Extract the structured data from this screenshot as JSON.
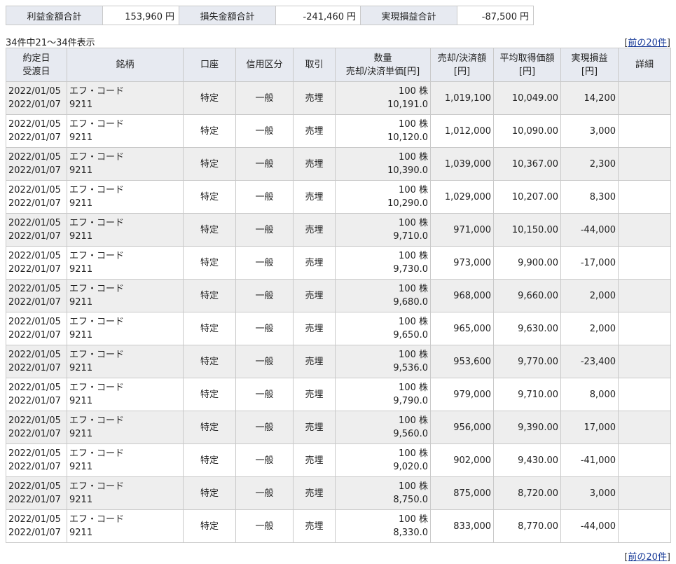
{
  "summary": {
    "profit_label": "利益金額合計",
    "profit_value": "153,960",
    "profit_unit": "円",
    "loss_label": "損失金額合計",
    "loss_value": "-241,460",
    "loss_unit": "円",
    "realized_label": "実現損益合計",
    "realized_value": "-87,500",
    "realized_unit": "円"
  },
  "count_text": "34件中21～34件表示",
  "prev_link": "前の20件",
  "headers": {
    "date1": "約定日",
    "date2": "受渡日",
    "stock": "銘柄",
    "account": "口座",
    "credit": "信用区分",
    "trade": "取引",
    "qty1": "数量",
    "qty2": "売却/決済単価[円]",
    "amount1": "売却/決済額",
    "amount2": "[円]",
    "avg1": "平均取得価額",
    "avg2": "[円]",
    "pnl1": "実現損益",
    "pnl2": "[円]",
    "detail": "詳細"
  },
  "rows": [
    {
      "trade_date": "2022/01/05",
      "settle_date": "2022/01/07",
      "name": "エフ・コード",
      "code": "9211",
      "account": "特定",
      "credit": "一般",
      "trade": "売埋",
      "qty": "100 株",
      "price": "10,191.0",
      "amount": "1,019,100",
      "avg": "10,049.00",
      "pnl": "14,200"
    },
    {
      "trade_date": "2022/01/05",
      "settle_date": "2022/01/07",
      "name": "エフ・コード",
      "code": "9211",
      "account": "特定",
      "credit": "一般",
      "trade": "売埋",
      "qty": "100 株",
      "price": "10,120.0",
      "amount": "1,012,000",
      "avg": "10,090.00",
      "pnl": "3,000"
    },
    {
      "trade_date": "2022/01/05",
      "settle_date": "2022/01/07",
      "name": "エフ・コード",
      "code": "9211",
      "account": "特定",
      "credit": "一般",
      "trade": "売埋",
      "qty": "100 株",
      "price": "10,390.0",
      "amount": "1,039,000",
      "avg": "10,367.00",
      "pnl": "2,300"
    },
    {
      "trade_date": "2022/01/05",
      "settle_date": "2022/01/07",
      "name": "エフ・コード",
      "code": "9211",
      "account": "特定",
      "credit": "一般",
      "trade": "売埋",
      "qty": "100 株",
      "price": "10,290.0",
      "amount": "1,029,000",
      "avg": "10,207.00",
      "pnl": "8,300"
    },
    {
      "trade_date": "2022/01/05",
      "settle_date": "2022/01/07",
      "name": "エフ・コード",
      "code": "9211",
      "account": "特定",
      "credit": "一般",
      "trade": "売埋",
      "qty": "100 株",
      "price": "9,710.0",
      "amount": "971,000",
      "avg": "10,150.00",
      "pnl": "-44,000"
    },
    {
      "trade_date": "2022/01/05",
      "settle_date": "2022/01/07",
      "name": "エフ・コード",
      "code": "9211",
      "account": "特定",
      "credit": "一般",
      "trade": "売埋",
      "qty": "100 株",
      "price": "9,730.0",
      "amount": "973,000",
      "avg": "9,900.00",
      "pnl": "-17,000"
    },
    {
      "trade_date": "2022/01/05",
      "settle_date": "2022/01/07",
      "name": "エフ・コード",
      "code": "9211",
      "account": "特定",
      "credit": "一般",
      "trade": "売埋",
      "qty": "100 株",
      "price": "9,680.0",
      "amount": "968,000",
      "avg": "9,660.00",
      "pnl": "2,000"
    },
    {
      "trade_date": "2022/01/05",
      "settle_date": "2022/01/07",
      "name": "エフ・コード",
      "code": "9211",
      "account": "特定",
      "credit": "一般",
      "trade": "売埋",
      "qty": "100 株",
      "price": "9,650.0",
      "amount": "965,000",
      "avg": "9,630.00",
      "pnl": "2,000"
    },
    {
      "trade_date": "2022/01/05",
      "settle_date": "2022/01/07",
      "name": "エフ・コード",
      "code": "9211",
      "account": "特定",
      "credit": "一般",
      "trade": "売埋",
      "qty": "100 株",
      "price": "9,536.0",
      "amount": "953,600",
      "avg": "9,770.00",
      "pnl": "-23,400"
    },
    {
      "trade_date": "2022/01/05",
      "settle_date": "2022/01/07",
      "name": "エフ・コード",
      "code": "9211",
      "account": "特定",
      "credit": "一般",
      "trade": "売埋",
      "qty": "100 株",
      "price": "9,790.0",
      "amount": "979,000",
      "avg": "9,710.00",
      "pnl": "8,000"
    },
    {
      "trade_date": "2022/01/05",
      "settle_date": "2022/01/07",
      "name": "エフ・コード",
      "code": "9211",
      "account": "特定",
      "credit": "一般",
      "trade": "売埋",
      "qty": "100 株",
      "price": "9,560.0",
      "amount": "956,000",
      "avg": "9,390.00",
      "pnl": "17,000"
    },
    {
      "trade_date": "2022/01/05",
      "settle_date": "2022/01/07",
      "name": "エフ・コード",
      "code": "9211",
      "account": "特定",
      "credit": "一般",
      "trade": "売埋",
      "qty": "100 株",
      "price": "9,020.0",
      "amount": "902,000",
      "avg": "9,430.00",
      "pnl": "-41,000"
    },
    {
      "trade_date": "2022/01/05",
      "settle_date": "2022/01/07",
      "name": "エフ・コード",
      "code": "9211",
      "account": "特定",
      "credit": "一般",
      "trade": "売埋",
      "qty": "100 株",
      "price": "8,750.0",
      "amount": "875,000",
      "avg": "8,720.00",
      "pnl": "3,000"
    },
    {
      "trade_date": "2022/01/05",
      "settle_date": "2022/01/07",
      "name": "エフ・コード",
      "code": "9211",
      "account": "特定",
      "credit": "一般",
      "trade": "売埋",
      "qty": "100 株",
      "price": "8,330.0",
      "amount": "833,000",
      "avg": "8,770.00",
      "pnl": "-44,000"
    }
  ]
}
